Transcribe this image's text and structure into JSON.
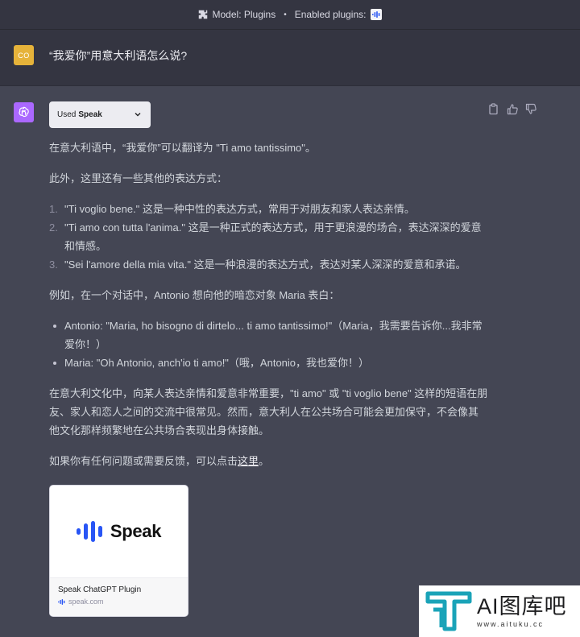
{
  "topbar": {
    "model_label": "Model: Plugins",
    "separator": "•",
    "enabled_label": "Enabled plugins:"
  },
  "user": {
    "avatar_initials": "CO",
    "avatar_color": "#e6b33a",
    "message": "“我爱你”用意大利语怎么说?"
  },
  "assistant": {
    "avatar_color": "#ab68ff",
    "plugin_used_prefix": "Used",
    "plugin_used_name": "Speak",
    "intro": "在意大利语中，“我爱你”可以翻译为 \"Ti amo tantissimo\"。",
    "also": "此外，这里还有一些其他的表达方式：",
    "numbered": [
      {
        "num": "1.",
        "text": "\"Ti voglio bene.\" 这是一种中性的表达方式，常用于对朋友和家人表达亲情。"
      },
      {
        "num": "2.",
        "text": "\"Ti amo con tutta l'anima.\" 这是一种正式的表达方式，用于更浪漫的场合，表达深深的爱意和情感。"
      },
      {
        "num": "3.",
        "text": "\"Sei l'amore della mia vita.\" 这是一种浪漫的表达方式，表达对某人深深的爱意和承诺。"
      }
    ],
    "example_intro": "例如，在一个对话中，Antonio 想向他的暗恋对象 Maria 表白：",
    "dialogue": [
      "Antonio: \"Maria, ho bisogno di dirtelo... ti amo tantissimo!\"（Maria，我需要告诉你...我非常爱你！）",
      "Maria: \"Oh Antonio, anch'io ti amo!\"（哦，Antonio，我也爱你！）"
    ],
    "culture": "在意大利文化中，向某人表达亲情和爱意非常重要，\"ti amo\" 或 \"ti voglio bene\" 这样的短语在朋友、家人和恋人之间的交流中很常见。然而，意大利人在公共场合可能会更加保守，不会像其他文化那样频繁地在公共场合表现出身体接触。",
    "feedback_prefix": "如果你有任何问题或需要反馈，可以点击",
    "feedback_link": "这里",
    "feedback_suffix": "。"
  },
  "card": {
    "logo_text": "Speak",
    "title": "Speak ChatGPT Plugin",
    "domain": "speak.com",
    "brand_color": "#2855f5"
  },
  "watermark": {
    "big": "AI图库吧",
    "small": "www.aituku.cc",
    "color": "#1aa3b8"
  }
}
